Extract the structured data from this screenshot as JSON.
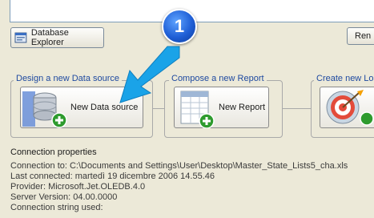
{
  "toolbar": {
    "database_explorer_label": "Database Explorer",
    "rename_label": "Ren"
  },
  "wizard": {
    "step_badge": "1",
    "groups": [
      {
        "label": "Design a new Data source",
        "button_label": "New Data source",
        "icon": "database-add-icon"
      },
      {
        "label": "Compose a new Report",
        "button_label": "New Report",
        "icon": "report-add-icon"
      },
      {
        "label": "Create new Loa",
        "button_label": "",
        "icon": "target-add-icon"
      }
    ]
  },
  "connection": {
    "title": "Connection properties",
    "connection_to": "Connection to: C:\\Documents and Settings\\User\\Desktop\\Master_State_Lists5_cha.xls",
    "last_connected": "Last connected: martedì 19 dicembre 2006 14.55.46",
    "provider": "Provider: Microsoft.Jet.OLEDB.4.0",
    "server_version": "Server Version: 04.00.0000",
    "connection_string": "Connection string used:"
  },
  "colors": {
    "accent_arrow": "#1aa3e8",
    "badge_blue": "#1f5fd6",
    "group_label": "#1f4aa0",
    "plus_green": "#2e9b2e"
  }
}
